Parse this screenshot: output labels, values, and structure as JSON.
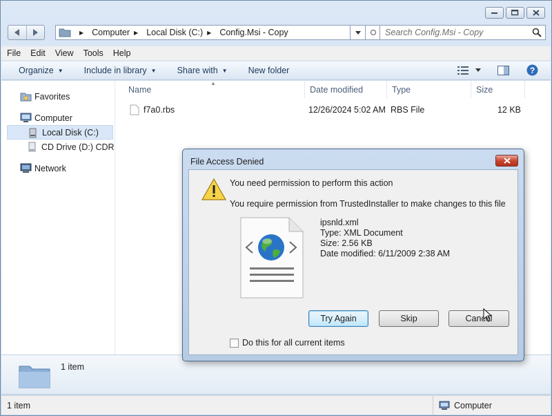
{
  "window": {
    "caption_buttons": [
      "minimize",
      "maximize",
      "close"
    ]
  },
  "address_bar": {
    "crumbs": [
      "Computer",
      "Local Disk (C:)",
      "Config.Msi - Copy"
    ]
  },
  "search": {
    "placeholder": "Search Config.Msi - Copy"
  },
  "menu": {
    "items": [
      "File",
      "Edit",
      "View",
      "Tools",
      "Help"
    ]
  },
  "toolbar": {
    "organize": "Organize",
    "include_in_library": "Include in library",
    "share_with": "Share with",
    "new_folder": "New folder"
  },
  "nav_pane": {
    "favorites": "Favorites",
    "computer": "Computer",
    "local_disk": "Local Disk (C:)",
    "cd_drive": "CD Drive (D:) CDROM",
    "network": "Network"
  },
  "columns": {
    "name": "Name",
    "date_modified": "Date modified",
    "type": "Type",
    "size": "Size"
  },
  "files": [
    {
      "name": "f7a0.rbs",
      "date": "12/26/2024 5:02 AM",
      "type": "RBS File",
      "size": "12 KB"
    }
  ],
  "details_pane": {
    "count": "1 item"
  },
  "status_bar": {
    "left": "1 item",
    "right": "Computer"
  },
  "dialog": {
    "title": "File Access Denied",
    "message": "You need permission to perform this action",
    "detail": "You require permission from TrustedInstaller to make changes to this file",
    "file": {
      "name": "ipsnld.xml",
      "type": "Type: XML Document",
      "size": "Size: 2.56 KB",
      "date_modified": "Date modified: 6/11/2009 2:38 AM"
    },
    "buttons": {
      "try_again": "Try Again",
      "skip": "Skip",
      "cancel": "Cancel"
    },
    "checkbox_label": "Do this for all current items",
    "checkbox_checked": false
  },
  "colors": {
    "window_frame": "#c4d5ea",
    "selection": "#d9e7f8",
    "close_button": "#c7472f",
    "default_button_border": "#3c7fb1"
  }
}
